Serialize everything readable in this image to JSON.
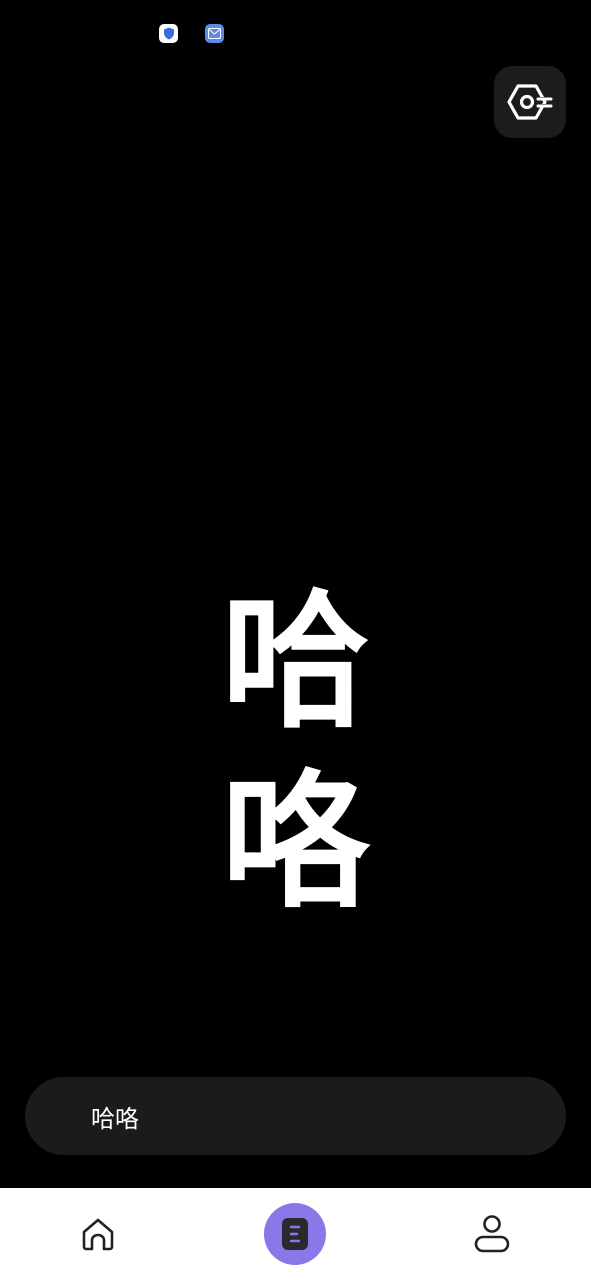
{
  "status_bar": {
    "icons": [
      "shield-icon",
      "mail-icon"
    ]
  },
  "header": {
    "settings_icon": "hex-settings-icon"
  },
  "main": {
    "line1": "哈",
    "line2": "咯"
  },
  "input": {
    "value": "哈咯"
  },
  "bottom_nav": {
    "items": [
      {
        "icon": "home-icon"
      },
      {
        "icon": "document-icon"
      },
      {
        "icon": "profile-icon"
      }
    ]
  },
  "colors": {
    "background": "#000000",
    "accent": "#8b78e8",
    "pill": "#1b1b1b"
  }
}
